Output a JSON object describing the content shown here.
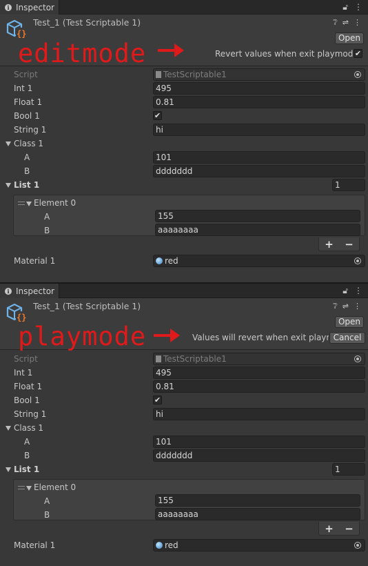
{
  "colors": {
    "annotation": "#e01a1a",
    "panel_bg": "#383838",
    "field_bg": "#2a2a2a"
  },
  "panels": [
    {
      "tab": {
        "icon": "info-icon",
        "label": "Inspector",
        "icons": [
          "lock-icon",
          "kebab-menu-icon"
        ]
      },
      "header": {
        "title": "Test_1 (Test Scriptable 1)",
        "header_icons": [
          "help-icon",
          "settings-sliders-icon",
          "kebab-menu-icon"
        ],
        "open_label": "Open",
        "annotation": "editmode",
        "revert_text": "Revert values when exit playmode",
        "revert_checked": "✔"
      },
      "fields": {
        "script_label": "Script",
        "script_value": "TestScriptable1",
        "int_label": "Int 1",
        "int_value": "495",
        "float_label": "Float 1",
        "float_value": "0.81",
        "bool_label": "Bool 1",
        "bool_value": "✔",
        "string_label": "String 1",
        "string_value": "hi",
        "class_label": "Class 1",
        "a_label": "A",
        "a_value": "101",
        "b_label": "B",
        "b_value": "ddddddd",
        "list_label": "List 1",
        "list_size": "1",
        "element_label": "Element 0",
        "el_a_label": "A",
        "el_a_value": "155",
        "el_b_label": "B",
        "el_b_value": "aaaaaaaa",
        "plus": "+",
        "minus": "−",
        "material_label": "Material 1",
        "material_value": "red"
      }
    },
    {
      "tab": {
        "icon": "info-icon",
        "label": "Inspector",
        "icons": [
          "lock-icon",
          "kebab-menu-icon"
        ]
      },
      "header": {
        "title": "Test_1 (Test Scriptable 1)",
        "header_icons": [
          "help-icon",
          "settings-sliders-icon",
          "kebab-menu-icon"
        ],
        "open_label": "Open",
        "annotation": "playmode",
        "revert_text": "Values will revert when exit playmo",
        "cancel_label": "Cancel"
      },
      "fields": {
        "script_label": "Script",
        "script_value": "TestScriptable1",
        "int_label": "Int 1",
        "int_value": "495",
        "float_label": "Float 1",
        "float_value": "0.81",
        "bool_label": "Bool 1",
        "bool_value": "✔",
        "string_label": "String 1",
        "string_value": "hi",
        "class_label": "Class 1",
        "a_label": "A",
        "a_value": "101",
        "b_label": "B",
        "b_value": "ddddddd",
        "list_label": "List 1",
        "list_size": "1",
        "element_label": "Element 0",
        "el_a_label": "A",
        "el_a_value": "155",
        "el_b_label": "B",
        "el_b_value": "aaaaaaaa",
        "plus": "+",
        "minus": "−",
        "material_label": "Material 1",
        "material_value": "red"
      }
    }
  ]
}
